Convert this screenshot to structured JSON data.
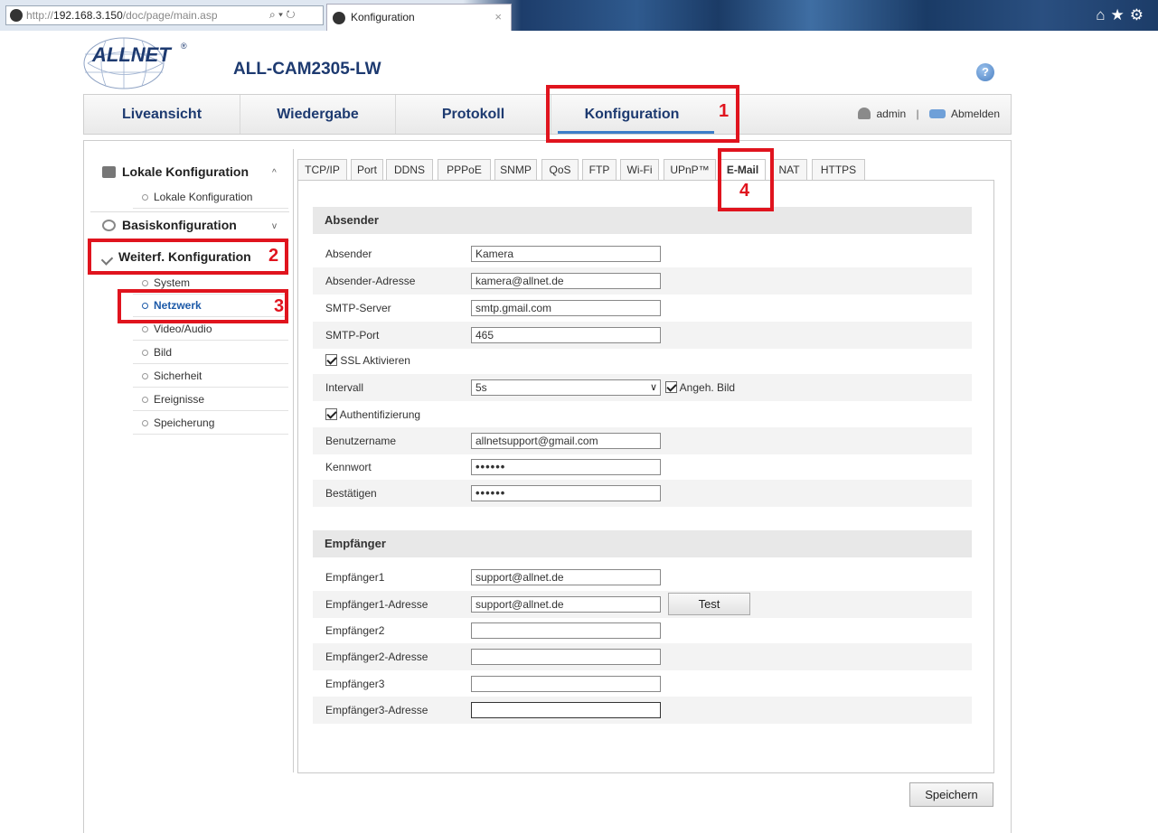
{
  "browser": {
    "url_host": "192.168.3.150",
    "url_prefix": "http://",
    "url_path": "/doc/page/main.asp",
    "url_controls": "⌕ ▾ ↻",
    "tab_title": "Konfiguration",
    "tab_close": "×",
    "toolbar_icons": "⌂★⚙"
  },
  "header": {
    "brand": "ALLNET",
    "registered": "®",
    "product": "ALL-CAM2305-LW",
    "help": "?"
  },
  "main_nav": {
    "items": [
      "Liveansicht",
      "Wiedergabe",
      "Protokoll",
      "Konfiguration"
    ],
    "user": "admin",
    "separator": "|",
    "logout": "Abmelden"
  },
  "sidebar": {
    "group1": "Lokale Konfiguration",
    "group1_items": [
      "Lokale Konfiguration"
    ],
    "group2": "Basiskonfiguration",
    "group3": "Weiterf. Konfiguration",
    "group3_items": [
      "System",
      "Netzwerk",
      "Video/Audio",
      "Bild",
      "Sicherheit",
      "Ereignisse",
      "Speicherung"
    ],
    "chev_up": "^",
    "chev_down": "v"
  },
  "tabs": [
    "TCP/IP",
    "Port",
    "DDNS",
    "PPPoE",
    "SNMP",
    "QoS",
    "FTP",
    "Wi-Fi",
    "UPnP™",
    "E-Mail",
    "NAT",
    "HTTPS"
  ],
  "sender": {
    "heading": "Absender",
    "absender_label": "Absender",
    "absender_value": "Kamera",
    "address_label": "Absender-Adresse",
    "address_value": "kamera@allnet.de",
    "smtp_server_label": "SMTP-Server",
    "smtp_server_value": "smtp.gmail.com",
    "smtp_port_label": "SMTP-Port",
    "smtp_port_value": "465",
    "ssl_label": "SSL Aktivieren",
    "interval_label": "Intervall",
    "interval_value": "5s",
    "attach_label": "Angeh. Bild",
    "auth_label": "Authentifizierung",
    "username_label": "Benutzername",
    "username_value": "allnetsupport@gmail.com",
    "password_label": "Kennwort",
    "password_value": "••••••",
    "confirm_label": "Bestätigen",
    "confirm_value": "••••••"
  },
  "receiver": {
    "heading": "Empfänger",
    "r1_label": "Empfänger1",
    "r1_value": "support@allnet.de",
    "r1_addr_label": "Empfänger1-Adresse",
    "r1_addr_value": "support@allnet.de",
    "test_label": "Test",
    "r2_label": "Empfänger2",
    "r2_value": "",
    "r2_addr_label": "Empfänger2-Adresse",
    "r2_addr_value": "",
    "r3_label": "Empfänger3",
    "r3_value": "",
    "r3_addr_label": "Empfänger3-Adresse",
    "r3_addr_value": ""
  },
  "save_label": "Speichern",
  "annotations": [
    "1",
    "2",
    "3",
    "4"
  ],
  "colors": {
    "accent": "#1d3a70",
    "annotation": "#e0141e",
    "tab_underline": "#3d7dc8"
  }
}
